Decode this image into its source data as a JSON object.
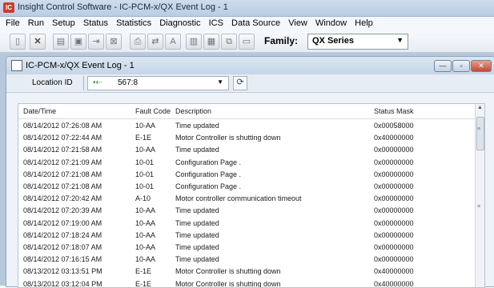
{
  "window": {
    "title": "Insight Control Software - IC-PCM-x/QX Event Log - 1"
  },
  "menu": [
    "File",
    "Run",
    "Setup",
    "Status",
    "Statistics",
    "Diagnostic",
    "ICS",
    "Data Source",
    "View",
    "Window",
    "Help"
  ],
  "toolbar": {
    "family_label": "Family:",
    "family_value": "QX Series"
  },
  "child": {
    "title": "IC-PCM-x/QX Event Log - 1"
  },
  "location": {
    "label": "Location ID",
    "value": "567:8"
  },
  "table": {
    "columns": [
      "Date/Time",
      "Fault Code",
      "Description",
      "Status Mask"
    ],
    "rows": [
      {
        "dt": "08/14/2012 07:26:08 AM",
        "code": "10-AA",
        "desc": "Time updated",
        "mask": "0x00058000"
      },
      {
        "dt": "08/14/2012 07:22:44 AM",
        "code": "E-1E",
        "desc": "Motor Controller is shutting down",
        "mask": "0x40000000"
      },
      {
        "dt": "08/14/2012 07:21:58 AM",
        "code": "10-AA",
        "desc": "Time updated",
        "mask": "0x00000000"
      },
      {
        "dt": "08/14/2012 07:21:09 AM",
        "code": "10-01",
        "desc": "Configuration Page .",
        "mask": "0x00000000"
      },
      {
        "dt": "08/14/2012 07:21:08 AM",
        "code": "10-01",
        "desc": "Configuration Page .",
        "mask": "0x00000000"
      },
      {
        "dt": "08/14/2012 07:21:08 AM",
        "code": "10-01",
        "desc": "Configuration Page .",
        "mask": "0x00000000"
      },
      {
        "dt": "08/14/2012 07:20:42 AM",
        "code": "A-10",
        "desc": "Motor controller communication timeout",
        "mask": "0x00000000"
      },
      {
        "dt": "08/14/2012 07:20:39 AM",
        "code": "10-AA",
        "desc": "Time updated",
        "mask": "0x00000000"
      },
      {
        "dt": "08/14/2012 07:19:00 AM",
        "code": "10-AA",
        "desc": "Time updated",
        "mask": "0x00000000"
      },
      {
        "dt": "08/14/2012 07:18:24 AM",
        "code": "10-AA",
        "desc": "Time updated",
        "mask": "0x00000000"
      },
      {
        "dt": "08/14/2012 07:18:07 AM",
        "code": "10-AA",
        "desc": "Time updated",
        "mask": "0x00000000"
      },
      {
        "dt": "08/14/2012 07:16:15 AM",
        "code": "10-AA",
        "desc": "Time updated",
        "mask": "0x00000000"
      },
      {
        "dt": "08/13/2012 03:13:51 PM",
        "code": "E-1E",
        "desc": "Motor Controller is shutting down",
        "mask": "0x40000000"
      },
      {
        "dt": "08/13/2012 03:12:04 PM",
        "code": "E-1E",
        "desc": "Motor Controller is shutting down",
        "mask": "0x40000000"
      }
    ]
  }
}
